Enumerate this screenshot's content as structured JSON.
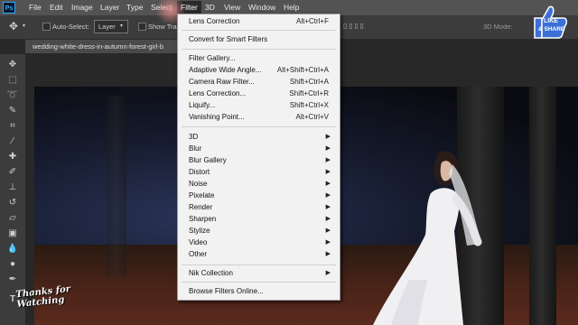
{
  "menubar": {
    "logo": "Ps",
    "items": [
      "File",
      "Edit",
      "Image",
      "Layer",
      "Type",
      "Select",
      "Filter",
      "3D",
      "View",
      "Window",
      "Help"
    ],
    "active": "Filter"
  },
  "options_bar": {
    "auto_select_label": "Auto-Select:",
    "auto_select_value": "Layer",
    "show_transform_label": "Show Tra",
    "mode_3d_label": "3D Mode:"
  },
  "document_tab": {
    "title": "wedding-white-dress-in-autumn-forest-girl-b"
  },
  "filter_menu": {
    "items": [
      {
        "label": "Lens Correction",
        "shortcut": "Alt+Ctrl+F",
        "group": 1
      },
      {
        "label": "Convert for Smart Filters",
        "shortcut": "",
        "group": 1
      },
      {
        "label": "Filter Gallery...",
        "shortcut": "",
        "group": 2
      },
      {
        "label": "Adaptive Wide Angle...",
        "shortcut": "Alt+Shift+Ctrl+A",
        "group": 2
      },
      {
        "label": "Camera Raw Filter...",
        "shortcut": "Shift+Ctrl+A",
        "group": 2
      },
      {
        "label": "Lens Correction...",
        "shortcut": "Shift+Ctrl+R",
        "group": 2
      },
      {
        "label": "Liquify...",
        "shortcut": "Shift+Ctrl+X",
        "group": 2
      },
      {
        "label": "Vanishing Point...",
        "shortcut": "Alt+Ctrl+V",
        "group": 2
      },
      {
        "label": "3D",
        "submenu": true,
        "group": 3
      },
      {
        "label": "Blur",
        "submenu": true,
        "group": 3
      },
      {
        "label": "Blur Gallery",
        "submenu": true,
        "group": 3
      },
      {
        "label": "Distort",
        "submenu": true,
        "group": 3
      },
      {
        "label": "Noise",
        "submenu": true,
        "group": 3
      },
      {
        "label": "Pixelate",
        "submenu": true,
        "group": 3
      },
      {
        "label": "Render",
        "submenu": true,
        "group": 3
      },
      {
        "label": "Sharpen",
        "submenu": true,
        "group": 3
      },
      {
        "label": "Stylize",
        "submenu": true,
        "group": 3
      },
      {
        "label": "Video",
        "submenu": true,
        "group": 3
      },
      {
        "label": "Other",
        "submenu": true,
        "group": 3
      },
      {
        "label": "Nik Collection",
        "submenu": true,
        "group": 4
      },
      {
        "label": "Browse Filters Online...",
        "shortcut": "",
        "group": 5
      }
    ]
  },
  "overlays": {
    "like_share_line1": "LIKE",
    "like_share_line2": "& SHARE",
    "thanks_line1": "Thanks for",
    "thanks_line2": "Watching"
  },
  "toolbar": {
    "tools": [
      "move-tool",
      "marquee-tool",
      "lasso-tool",
      "quick-select-tool",
      "crop-tool",
      "eyedropper-tool",
      "healing-tool",
      "brush-tool",
      "clone-stamp-tool",
      "history-brush-tool",
      "eraser-tool",
      "gradient-tool",
      "blur-tool",
      "dodge-tool",
      "pen-tool",
      "type-tool"
    ]
  },
  "colors": {
    "menubar_bg": "#535353",
    "panel_bg": "#3c3c3c",
    "menu_bg": "#f2f2f2",
    "accent": "#31a8ff"
  }
}
